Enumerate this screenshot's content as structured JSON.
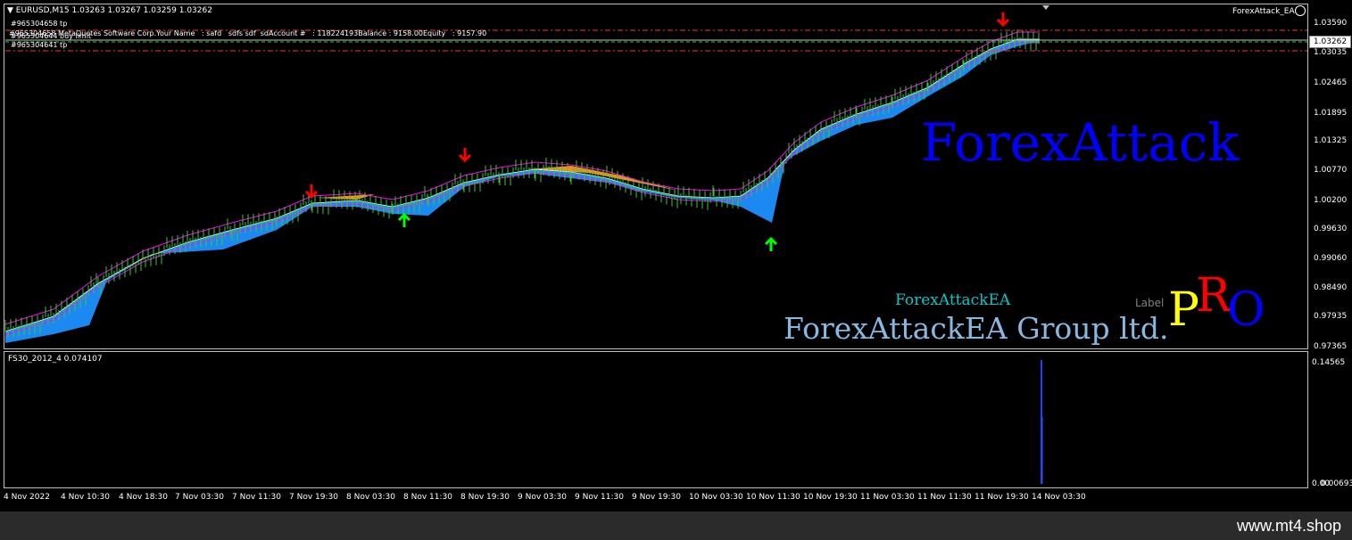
{
  "chart": {
    "header": "EURUSD,M15  1.03263 1.03267 1.03259 1.03262",
    "ea_name": "ForexAttack_EA",
    "current_price": "1.03262",
    "orders": [
      "#965304658 tp",
      "#965304644 buy limit",
      "#965304641 tp"
    ],
    "info_line": "#965304658 MetaQuotes Software Corp.Your Name   : safd   sdfs sdf  sdAccount #   : 118224193Balance : 9158.00Equity   : 9157.90",
    "price_ticks": [
      "1.03590",
      "1.03035",
      "1.02465",
      "1.01895",
      "1.01325",
      "1.00770",
      "1.00200",
      "0.99630",
      "0.99060",
      "0.98490",
      "0.97935",
      "0.97365"
    ],
    "time_ticks": [
      "4 Nov 2022",
      "4 Nov 10:30",
      "4 Nov 18:30",
      "7 Nov 03:30",
      "7 Nov 11:30",
      "7 Nov 19:30",
      "8 Nov 03:30",
      "8 Nov 11:30",
      "8 Nov 19:30",
      "9 Nov 03:30",
      "9 Nov 11:30",
      "9 Nov 19:30",
      "10 Nov 03:30",
      "10 Nov 11:30",
      "10 Nov 19:30",
      "11 Nov 03:30",
      "11 Nov 11:30",
      "11 Nov 19:30",
      "14 Nov 03:30"
    ],
    "sub_indicator": "FS30_2012_4 0.074107",
    "sub_ticks": [
      "0.14565",
      "0.00",
      "0.006936"
    ],
    "colors": {
      "bull_band": "#1e90ff",
      "bear_band": "#ff8c1a",
      "candles": "#32cd32",
      "ma_magenta": "#ff00ff",
      "arrow_up": "#00ff00",
      "arrow_down": "#ff0000"
    }
  },
  "branding": {
    "big": "ForexAttack",
    "small": "ForexAttackEA",
    "group": "ForexAttackEA Group ltd.",
    "label": "Label",
    "pro_p": "P",
    "pro_r": "R",
    "pro_o": "O"
  },
  "footer": {
    "site": "www.mt4.shop"
  }
}
